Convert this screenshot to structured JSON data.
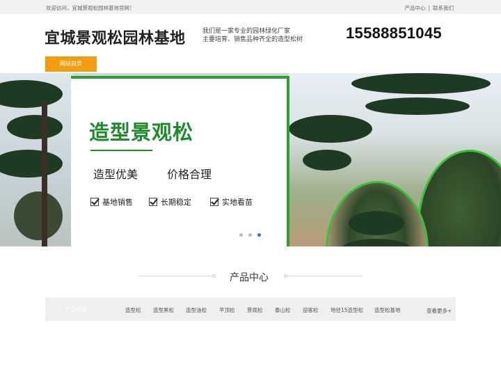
{
  "topbar": {
    "welcome": "欢迎访问，宜城景观松园林基地官网！",
    "link_products": "产品中心",
    "separator": "|",
    "link_contact": "联系我们"
  },
  "header": {
    "site_title": "宜城景观松园林基地",
    "tagline_line1": "我们是一家专业的园林绿化厂家",
    "tagline_line2": "主要培育、销售品种齐全的造型松树",
    "phone": "15588851045"
  },
  "nav": {
    "home": "网站首页",
    "active_color": "#f39c12"
  },
  "banner": {
    "title": "造型景观松",
    "sub1": "造型优美",
    "sub2": "价格合理",
    "features": [
      "基地销售",
      "长期稳定",
      "实地看苗"
    ],
    "accent_color": "#1e8b2a",
    "slides_total": 3,
    "active_slide": 3
  },
  "products": {
    "section_title": "产品中心",
    "category_head": "产品栏目",
    "categories": [
      "造型松",
      "造型黑松",
      "造型油松",
      "平顶松",
      "景观松",
      "泰山松",
      "迎客松",
      "地径15造型松",
      "造型松基地"
    ],
    "more": "查看更多+"
  }
}
